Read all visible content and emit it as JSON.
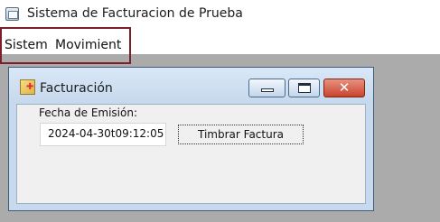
{
  "app": {
    "title": "Sistema de Facturacion de Prueba",
    "icon": "app-window-icon"
  },
  "menubar": {
    "items": [
      {
        "label": "Sistem"
      },
      {
        "label": "Movimient"
      }
    ]
  },
  "dialog": {
    "title": "Facturación",
    "icon": "invoice-icon",
    "controls": {
      "minimize_icon": "minimize-icon",
      "maximize_icon": "maximize-icon",
      "close_glyph": "✕"
    },
    "fecha_label": "Fecha de Emisión:",
    "fecha_value": "2024-04-30t09:12:05",
    "timbrar_button": "Timbrar Factura"
  },
  "colors": {
    "desktop": "#ababab",
    "highlight_border": "#7a1f2b",
    "window_frame": "#c7d9ec",
    "close_button": "#c9442e"
  }
}
